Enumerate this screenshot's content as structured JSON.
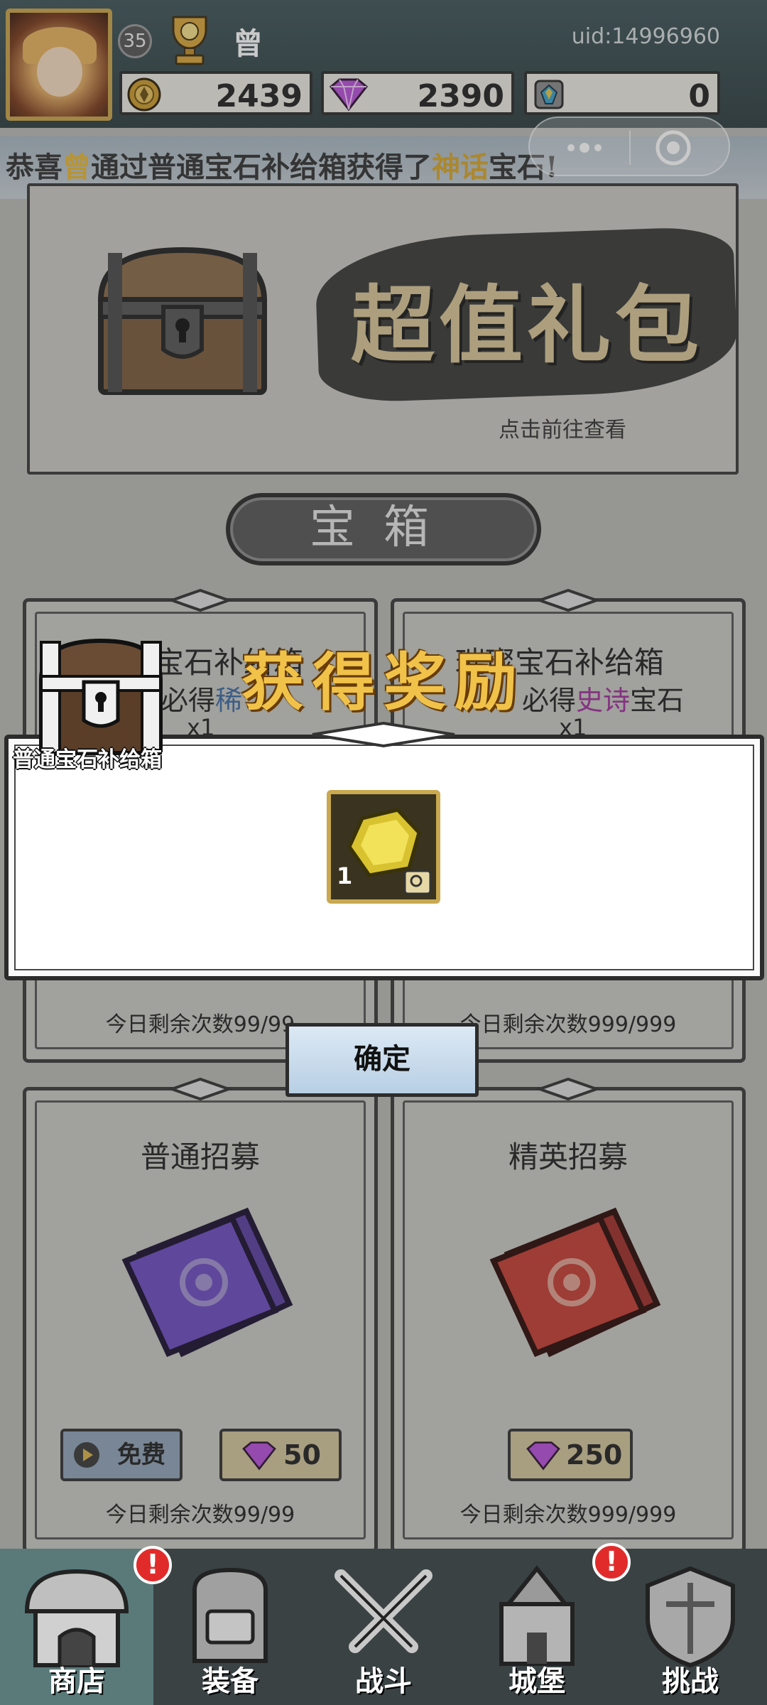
{
  "player": {
    "level": "35",
    "name": "曾",
    "uid": "uid:14996960"
  },
  "resources": {
    "gold": "2439",
    "diamonds": "2390",
    "crystals": "0"
  },
  "announcement": {
    "prefix": "恭喜",
    "name": "曾",
    "mid": "通过普通宝石补给箱获得了",
    "rarity": "神话",
    "suffix": "宝石!"
  },
  "banner": {
    "title": "超值礼包",
    "hint": "点击前往查看"
  },
  "section": {
    "title": "宝箱"
  },
  "cards": {
    "normal_gem": {
      "title": "普通宝石补给箱",
      "title_visible": "宝石补给箱",
      "guarantee_prefix": "必得",
      "guarantee_rarity": "稀",
      "count": "x1",
      "remain": "今日剩余次数99/99"
    },
    "shiny_gem": {
      "title": "璀璨宝石补给箱",
      "guarantee_prefix": "必得",
      "guarantee_rarity": "史诗",
      "guarantee_suffix": "宝石",
      "count": "x1",
      "remain": "今日剩余次数999/999"
    },
    "normal_recruit": {
      "title": "普通招募",
      "free_label": "免费",
      "gem_price": "50",
      "remain": "今日剩余次数99/99"
    },
    "elite_recruit": {
      "title": "精英招募",
      "gem_price": "250",
      "remain": "今日剩余次数999/999"
    }
  },
  "reward_modal": {
    "title": "获得奖励",
    "chest_label": "普通宝石补给箱",
    "item_qty": "1",
    "confirm_label": "确定"
  },
  "nav": {
    "items": [
      {
        "label": "商店",
        "active": true,
        "badge": "!"
      },
      {
        "label": "装备",
        "active": false
      },
      {
        "label": "战斗",
        "active": false
      },
      {
        "label": "城堡",
        "active": false,
        "badge": "!"
      },
      {
        "label": "挑战",
        "active": false
      }
    ]
  },
  "colors": {
    "accent_gold": "#f1c24a",
    "rarity_blue": "#3c6aa3",
    "rarity_purple": "#a0309c",
    "badge_red": "#e12b2b"
  }
}
